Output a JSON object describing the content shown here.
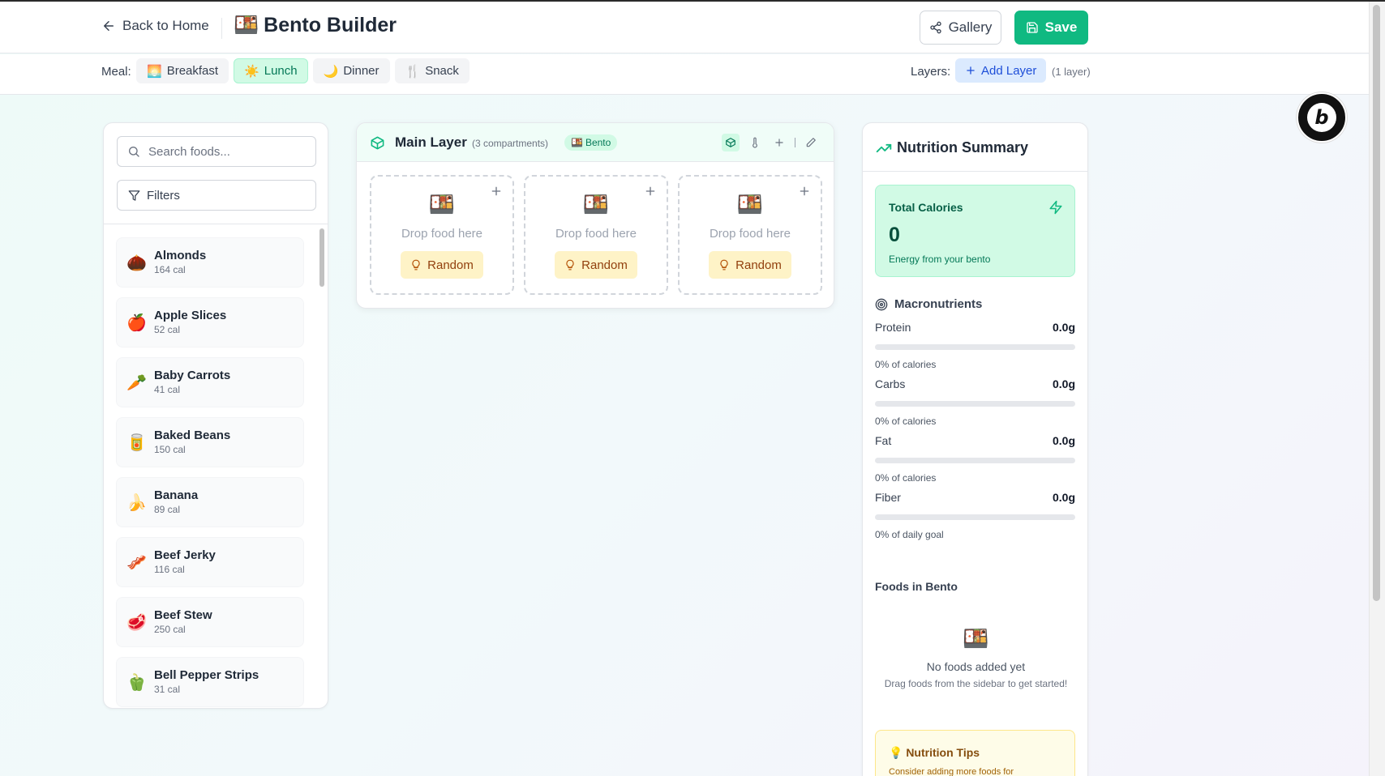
{
  "header": {
    "back_label": "Back to Home",
    "app_emoji": "🍱",
    "title": "Bento Builder",
    "gallery_label": "Gallery",
    "save_label": "Save"
  },
  "meal_bar": {
    "label": "Meal:",
    "tabs": [
      {
        "emoji": "🌅",
        "label": "Breakfast",
        "active": false
      },
      {
        "emoji": "☀️",
        "label": "Lunch",
        "active": true
      },
      {
        "emoji": "🌙",
        "label": "Dinner",
        "active": false
      },
      {
        "emoji": "🍴",
        "label": "Snack",
        "active": false
      }
    ],
    "layers_label": "Layers:",
    "add_layer_label": "Add Layer",
    "layer_count": "(1 layer)"
  },
  "sidebar": {
    "search_placeholder": "Search foods...",
    "filters_label": "Filters",
    "foods": [
      {
        "emoji": "🌰",
        "name": "Almonds",
        "cal": "164 cal"
      },
      {
        "emoji": "🍎",
        "name": "Apple Slices",
        "cal": "52 cal"
      },
      {
        "emoji": "🥕",
        "name": "Baby Carrots",
        "cal": "41 cal"
      },
      {
        "emoji": "🥫",
        "name": "Baked Beans",
        "cal": "150 cal"
      },
      {
        "emoji": "🍌",
        "name": "Banana",
        "cal": "89 cal"
      },
      {
        "emoji": "🥓",
        "name": "Beef Jerky",
        "cal": "116 cal"
      },
      {
        "emoji": "🥩",
        "name": "Beef Stew",
        "cal": "250 cal"
      },
      {
        "emoji": "🫑",
        "name": "Bell Pepper Strips",
        "cal": "31 cal"
      }
    ]
  },
  "layer": {
    "title": "Main Layer",
    "subtitle": "(3 compartments)",
    "badge_emoji": "🍱",
    "badge_label": "Bento",
    "compartments": [
      {
        "emoji": "🍱",
        "placeholder": "Drop food here",
        "random_label": "Random"
      },
      {
        "emoji": "🍱",
        "placeholder": "Drop food here",
        "random_label": "Random"
      },
      {
        "emoji": "🍱",
        "placeholder": "Drop food here",
        "random_label": "Random"
      }
    ]
  },
  "nutrition": {
    "title": "Nutrition Summary",
    "total_label": "Total Calories",
    "total_value": "0",
    "total_sub": "Energy from your bento",
    "macros_title": "Macronutrients",
    "macros": [
      {
        "name": "Protein",
        "value": "0.0g",
        "pct_text": "0% of calories",
        "fill": 0
      },
      {
        "name": "Carbs",
        "value": "0.0g",
        "pct_text": "0% of calories",
        "fill": 0
      },
      {
        "name": "Fat",
        "value": "0.0g",
        "pct_text": "0% of calories",
        "fill": 0
      },
      {
        "name": "Fiber",
        "value": "0.0g",
        "pct_text": "0% of daily goal",
        "fill": 0
      }
    ],
    "foods_title": "Foods in Bento",
    "empty_emoji": "🍱",
    "empty_title": "No foods added yet",
    "empty_sub": "Drag foods from the sidebar to get started!",
    "tips_title": "💡 Nutrition Tips",
    "tips_text": "Consider adding more foods for"
  },
  "badge": {
    "letter": "b"
  },
  "colors": {
    "accent": "#10b981",
    "active_tab_bg": "#d1fae5",
    "random_bg": "#fef3c7",
    "add_layer_bg": "#dbeafe"
  },
  "icons": {
    "back": "arrow-left-icon",
    "gallery": "share-icon",
    "save": "floppy-disk-icon",
    "search": "search-icon",
    "filters": "filter-icon",
    "layer": "box-icon",
    "random": "lightbulb-icon",
    "trend": "trending-up-icon",
    "bolt": "lightning-icon",
    "target": "target-icon"
  }
}
